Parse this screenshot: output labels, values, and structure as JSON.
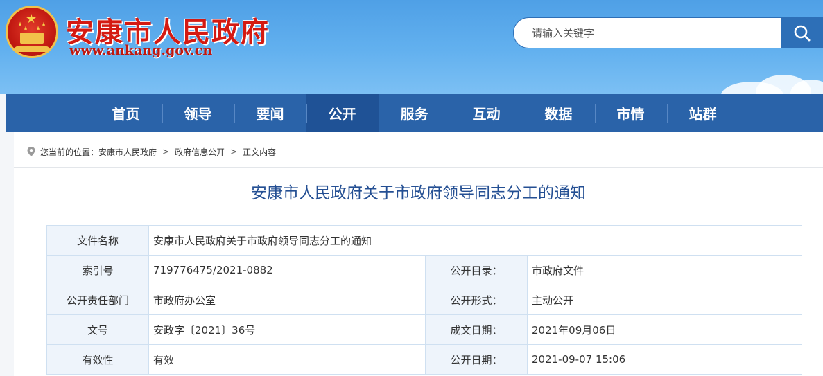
{
  "header": {
    "site_title": "安康市人民政府",
    "site_url": "www.ankang.gov.cn",
    "search_placeholder": "请输入关键字"
  },
  "nav": {
    "items": [
      "首页",
      "领导",
      "要闻",
      "公开",
      "服务",
      "互动",
      "数据",
      "市情",
      "站群"
    ],
    "active": "公开"
  },
  "breadcrumb": {
    "prefix": "您当前的位置：",
    "items": [
      "安康市人民政府",
      "政府信息公开",
      "正文内容"
    ],
    "separator": ">"
  },
  "document": {
    "title": "安康市人民政府关于市政府领导同志分工的通知"
  },
  "info": {
    "file_name_label": "文件名称",
    "file_name": "安康市人民政府关于市政府领导同志分工的通知",
    "index_label": "索引号",
    "index": "719776475/2021-0882",
    "catalog_label": "公开目录：",
    "catalog": "市政府文件",
    "dept_label": "公开责任部门",
    "dept": "市政府办公室",
    "form_label": "公开形式：",
    "form": "主动公开",
    "doc_no_label": "文号",
    "doc_no": "安政字〔2021〕36号",
    "written_label": "成文日期：",
    "written": "2021年09月06日",
    "validity_label": "有效性",
    "validity": "有效",
    "publish_label": "公开日期：",
    "publish": "2021-09-07 15:06"
  },
  "colors": {
    "nav_bg": "#2a63a9",
    "title_blue": "#244f93",
    "brand_red": "#d41a12"
  }
}
